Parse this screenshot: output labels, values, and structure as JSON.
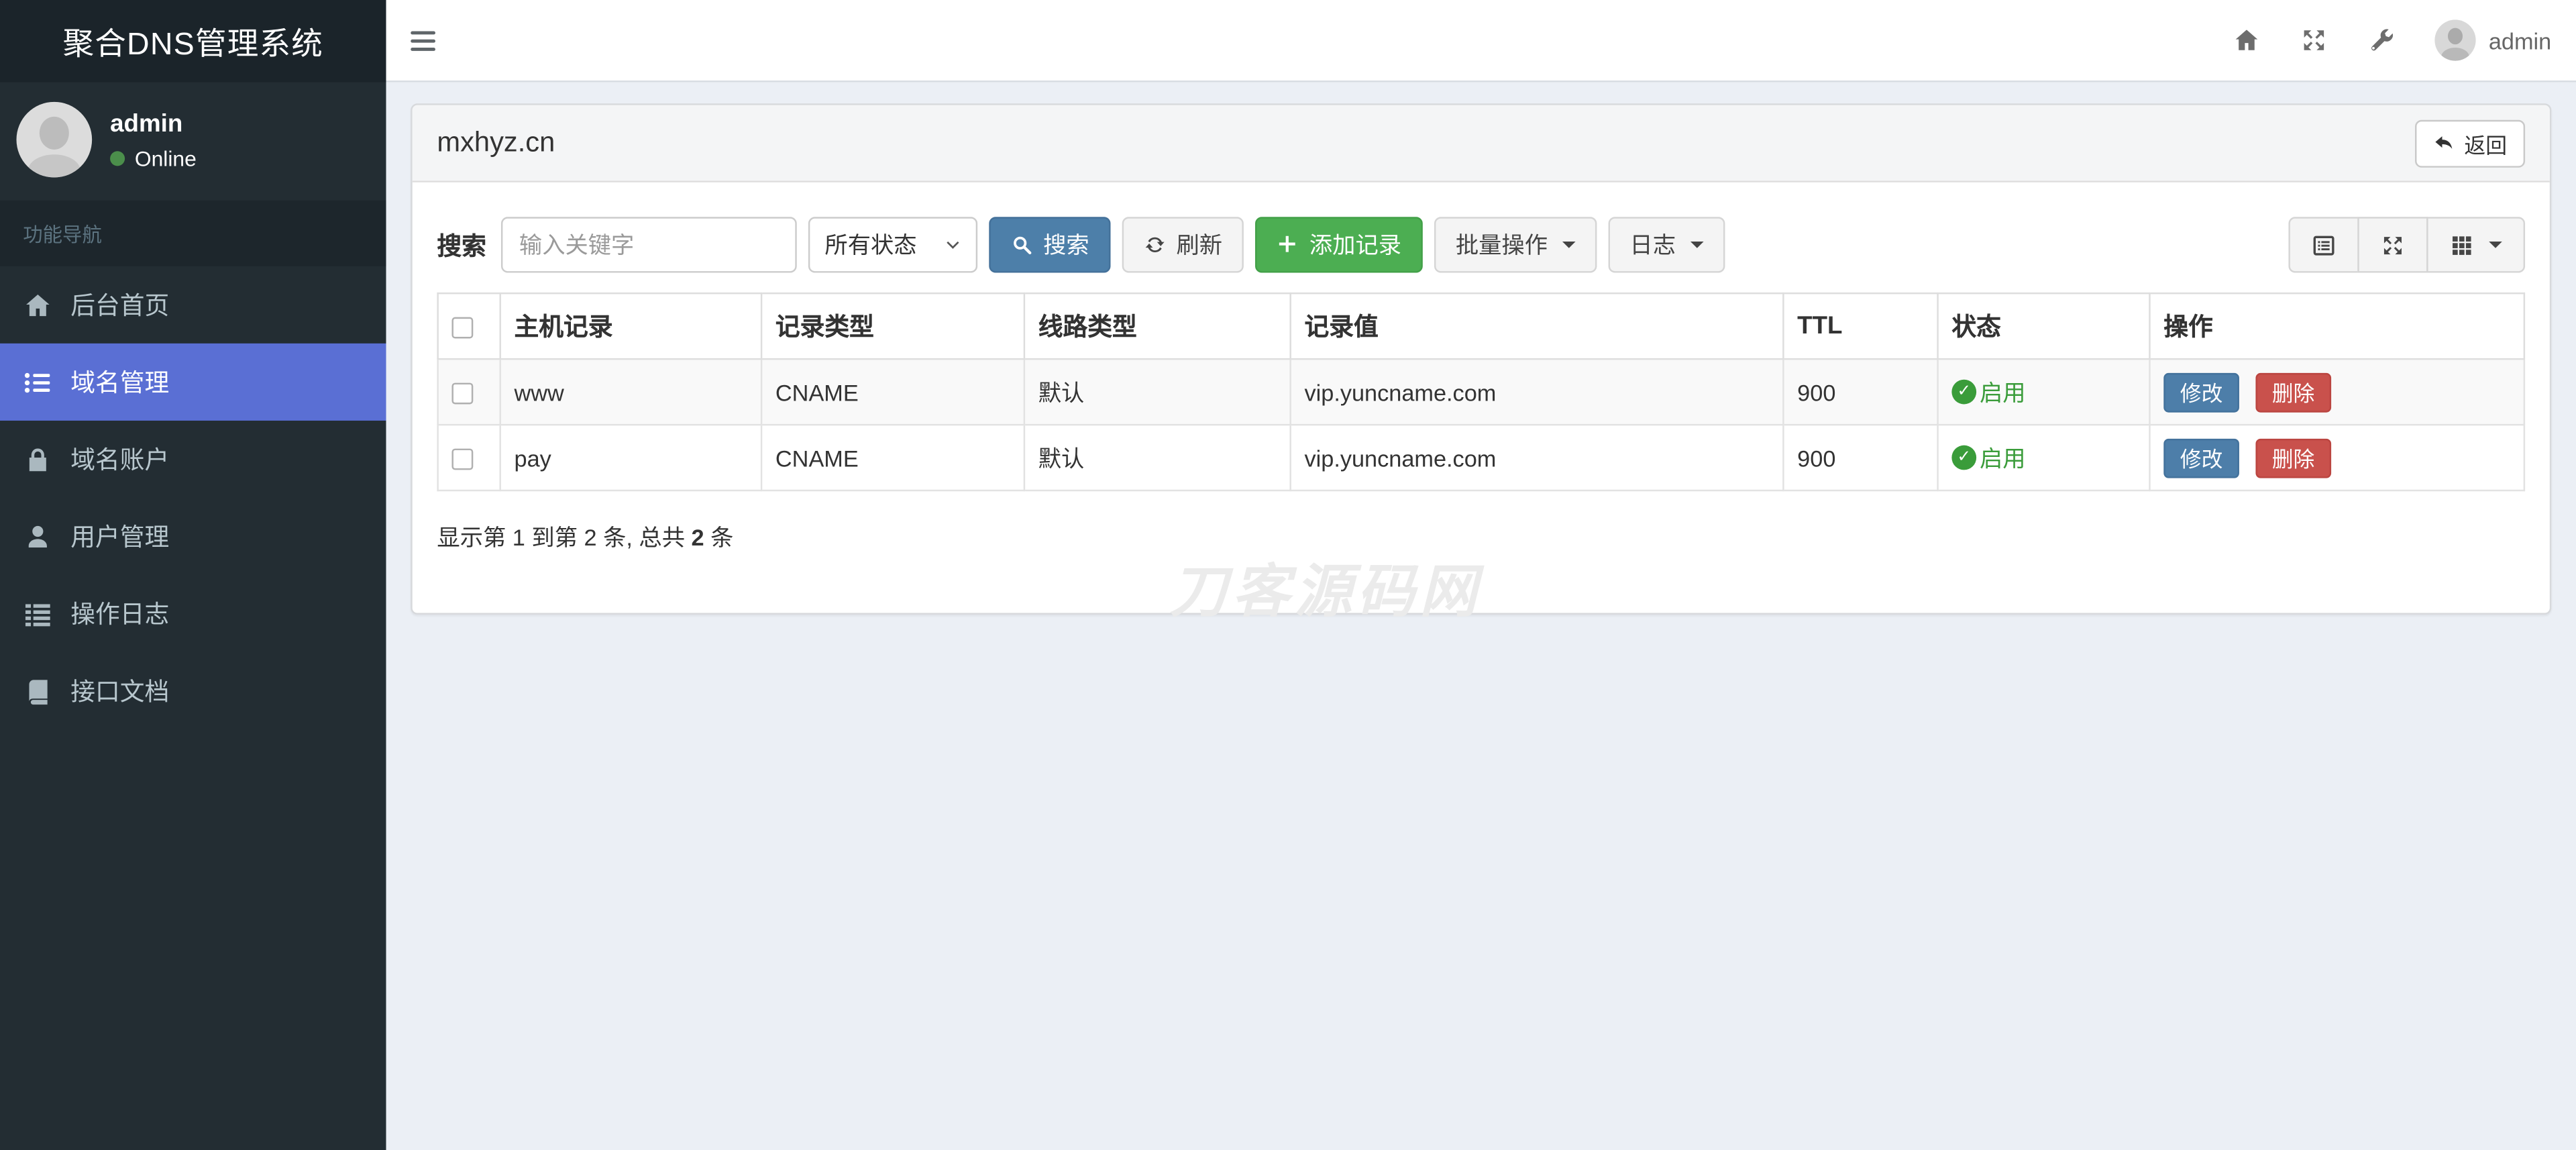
{
  "app": {
    "title": "聚合DNS管理系统"
  },
  "navbar": {
    "username": "admin"
  },
  "sidebar": {
    "user_name": "admin",
    "user_status": "Online",
    "nav_header": "功能导航",
    "items": [
      {
        "label": "后台首页"
      },
      {
        "label": "域名管理"
      },
      {
        "label": "域名账户"
      },
      {
        "label": "用户管理"
      },
      {
        "label": "操作日志"
      },
      {
        "label": "接口文档"
      }
    ]
  },
  "panel": {
    "title": "mxhyz.cn",
    "back_label": "返回"
  },
  "toolbar": {
    "search_label": "搜索",
    "keyword_placeholder": "输入关键字",
    "status_filter_value": "所有状态",
    "search_button": "搜索",
    "refresh_button": "刷新",
    "add_record_button": "添加记录",
    "batch_button": "批量操作",
    "log_button": "日志"
  },
  "table": {
    "headers": {
      "host": "主机记录",
      "type": "记录类型",
      "line": "线路类型",
      "value": "记录值",
      "ttl": "TTL",
      "status": "状态",
      "actions": "操作"
    },
    "rows": [
      {
        "host": "www",
        "type": "CNAME",
        "line": "默认",
        "value": "vip.yuncname.com",
        "ttl": "900",
        "status": "启用"
      },
      {
        "host": "pay",
        "type": "CNAME",
        "line": "默认",
        "value": "vip.yuncname.com",
        "ttl": "900",
        "status": "启用"
      }
    ],
    "actions": {
      "edit": "修改",
      "delete": "删除"
    },
    "summary": {
      "part1": "显示第 1 到第 2 条, 总共 ",
      "total": "2",
      "part2": " 条"
    }
  },
  "watermark": "刀客源码网",
  "colors": {
    "sidebar_bg": "#232d33",
    "active_item": "#5a6fd4",
    "accent_blue": "#4d7fa9",
    "accent_green": "#4cae52",
    "accent_red": "#c9514c",
    "status_green": "#3a9c3a"
  }
}
